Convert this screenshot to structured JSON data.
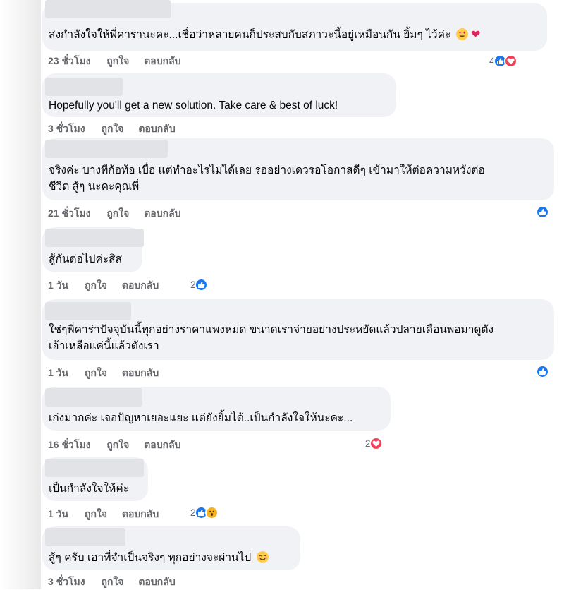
{
  "comments": [
    {
      "text": "ส่งกำลังใจให้พี่คาร่านะคะ...เชื่อว่าหลายคนก็ประสบกับสภาวะนี้อยู่เหมือนกัน ยิ้มๆ ไว้ค่ะ",
      "emoji": [
        "heart-eyes-emoji",
        "heart-emoji"
      ],
      "time": "23 ชั่วโมง",
      "like": "ถูกใจ",
      "reply": "ตอบกลับ",
      "reaction_count": "4",
      "reactions": [
        "like",
        "love"
      ]
    },
    {
      "text": "Hopefully you'll get a new solution. Take care & best of luck!",
      "time": "3 ชั่วโมง",
      "like": "ถูกใจ",
      "reply": "ตอบกลับ",
      "reaction_count": "",
      "reactions": []
    },
    {
      "text_lines": [
        "จริงค่ะ บางทีก้อท้อ เบื่อ แต่ทำอะไรไม่ได้เลย รออย่างเดวรอโอกาสดีๆ เข้ามาให้ต่อความหวังต่อ",
        "ชีวิต สู้ๆ นะคะคุณพี่"
      ],
      "time": "21 ชั่วโมง",
      "like": "ถูกใจ",
      "reply": "ตอบกลับ",
      "reaction_count": "",
      "reactions": [
        "like"
      ]
    },
    {
      "text": "สู้กันต่อไปค่ะสิส",
      "time": "1 วัน",
      "like": "ถูกใจ",
      "reply": "ตอบกลับ",
      "reaction_count": "2",
      "reactions": [
        "like"
      ]
    },
    {
      "text_lines": [
        "ใช่ๆพี่คาร่าปัจจุบันนี้ทุกอย่างราคาแพงหมด ขนาดเราจ่ายอย่างประหยัดแล้วปลายเดือนพอมาดูตัง",
        "เอ้าเหลือแค่นี้แล้วตังเรา"
      ],
      "time": "1 วัน",
      "like": "ถูกใจ",
      "reply": "ตอบกลับ",
      "reaction_count": "",
      "reactions": [
        "like"
      ]
    },
    {
      "text": "เก่งมากค่ะ เจอปัญหาเยอะแยะ แต่ยังยิ้มได้..เป็นกำลังใจให้นะคะ...",
      "time": "16 ชั่วโมง",
      "like": "ถูกใจ",
      "reply": "ตอบกลับ",
      "reaction_count": "2",
      "reactions": [
        "love"
      ]
    },
    {
      "text": "เป็นกำลังใจให้ค่ะ",
      "time": "1 วัน",
      "like": "ถูกใจ",
      "reply": "ตอบกลับ",
      "reaction_count": "2",
      "reactions": [
        "like",
        "wow"
      ]
    },
    {
      "text": "สู้ๆ ครับ เอาที่จำเป็นจริงๆ ทุกอย่างจะผ่านไป",
      "emoji": [
        "smile-emoji"
      ],
      "time": "3 ชั่วโมง",
      "like": "ถูกใจ",
      "reply": "ตอบกลับ",
      "reaction_count": "",
      "reactions": []
    }
  ]
}
